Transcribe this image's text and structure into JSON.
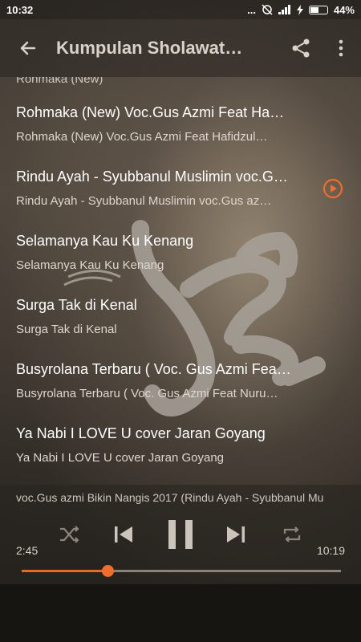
{
  "status": {
    "time": "10:32",
    "dots": "...",
    "battery_text": "44%",
    "battery_level": 0.44
  },
  "toolbar": {
    "title": "Kumpulan Sholawat…",
    "back_icon": "back-arrow-icon",
    "share_icon": "share-icon",
    "more_icon": "more-vertical-icon"
  },
  "list": {
    "partial_item": "Rohmaka (New)",
    "items": [
      {
        "title": "Rohmaka (New) Voc.Gus Azmi Feat Ha…",
        "subtitle": "Rohmaka (New) Voc.Gus Azmi Feat Hafidzul…"
      },
      {
        "title": "Rindu Ayah - Syubbanul Muslimin voc.G…",
        "subtitle": "Rindu Ayah - Syubbanul Muslimin voc.Gus az…"
      },
      {
        "title": "Selamanya Kau Ku Kenang",
        "subtitle": "Selamanya Kau Ku Kenang"
      },
      {
        "title": "Surga Tak di Kenal",
        "subtitle": "Surga Tak di Kenal"
      },
      {
        "title": "Busyrolana Terbaru ( Voc. Gus Azmi Fea…",
        "subtitle": "Busyrolana Terbaru ( Voc. Gus Azmi Feat Nuru…"
      },
      {
        "title": "Ya Nabi I LOVE U cover Jaran Goyang",
        "subtitle": "Ya Nabi I LOVE U cover Jaran Goyang"
      }
    ]
  },
  "player": {
    "now_playing": "voc.Gus azmi Bikin Nangis 2017 (Rindu Ayah - Syubbanul Mu",
    "elapsed": "2:45",
    "duration": "10:19",
    "progress": 0.27,
    "accent": "#f06d2b"
  }
}
